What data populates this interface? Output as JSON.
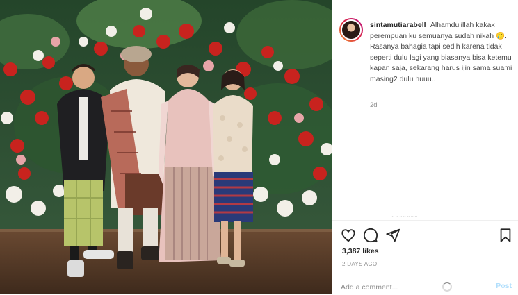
{
  "post": {
    "username": "sintamutiarabell",
    "caption": "Alhamdulillah kakak perempuan ku semuanya sudah nikah 🥲. Rasanya bahagia tapi sedih karena tidak seperti dulu lagi yang biasanya bisa ketemu kapan saja, sekarang harus ijin sama suami masing2 dulu huuu..",
    "time_ago": "2d",
    "likes": "3,387 likes",
    "date": "2 DAYS AGO"
  },
  "icons": {
    "like": "heart-icon",
    "comment": "comment-icon",
    "share": "share-icon",
    "save": "bookmark-icon"
  },
  "comment_box": {
    "placeholder": "Add a comment...",
    "post_label": "Post"
  },
  "colors": {
    "post_button_disabled": "#b2dffc",
    "secondary_text": "#8e8e8e",
    "avatar_ring_start": "#f09433",
    "avatar_ring_end": "#bc1888"
  }
}
